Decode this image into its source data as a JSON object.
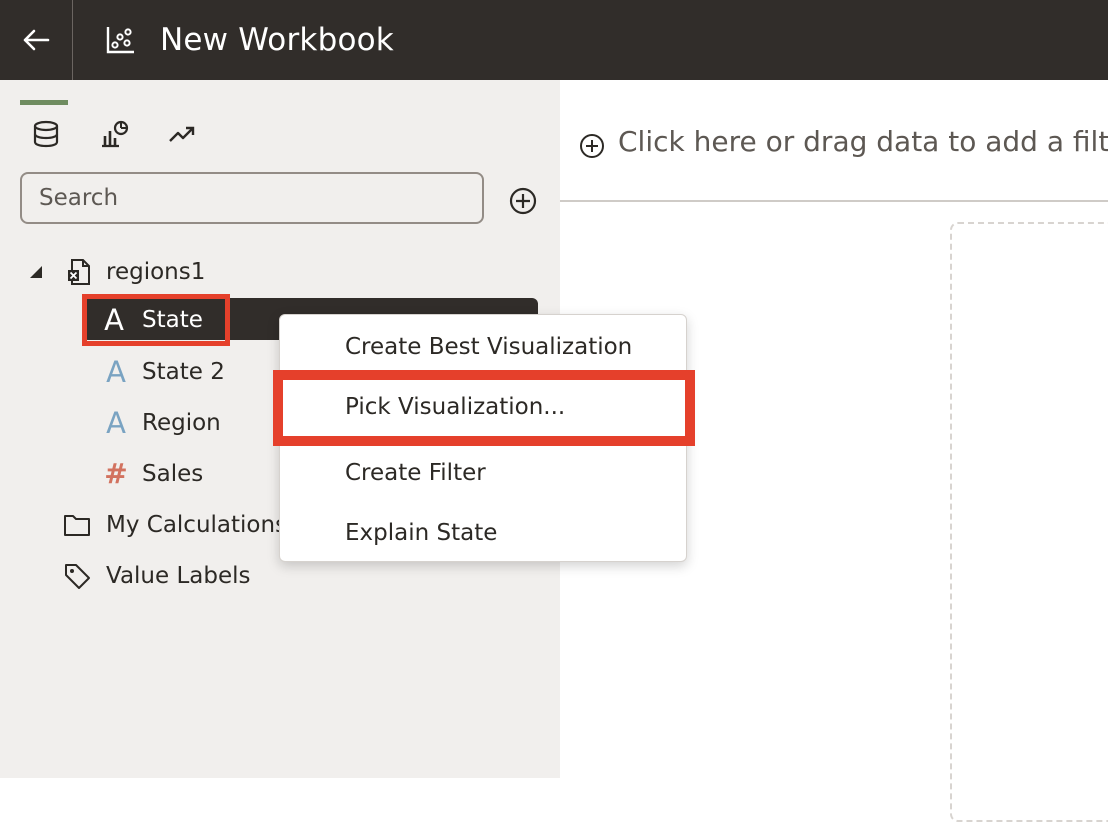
{
  "header": {
    "title": "New Workbook",
    "back_icon": "arrow-left-icon",
    "workbook_icon": "chart-icon"
  },
  "left_panel": {
    "tabs": [
      {
        "name": "data",
        "icon": "database-icon",
        "active": true
      },
      {
        "name": "visualizations",
        "icon": "visualizations-icon",
        "active": false
      },
      {
        "name": "analytics",
        "icon": "trend-icon",
        "active": false
      }
    ],
    "search": {
      "placeholder": "Search",
      "value": ""
    },
    "tree": {
      "dataset": {
        "label": "regions1",
        "icon": "excel-file-icon"
      },
      "columns": [
        {
          "label": "State",
          "type": "text",
          "selected": true
        },
        {
          "label": "State 2",
          "type": "text"
        },
        {
          "label": "Region",
          "type": "text"
        },
        {
          "label": "Sales",
          "type": "number"
        }
      ],
      "folders": [
        {
          "label": "My Calculations",
          "icon": "folder-icon"
        },
        {
          "label": "Value Labels",
          "icon": "tag-icon"
        }
      ]
    }
  },
  "filter_bar": {
    "hint": "Click here or drag data to add a filter"
  },
  "context_menu": {
    "items": [
      {
        "label": "Create Best Visualization"
      },
      {
        "label": "Pick Visualization...",
        "highlighted": true
      },
      {
        "label": "Create Filter"
      },
      {
        "label": "Explain State"
      }
    ]
  },
  "colors": {
    "topbar": "#312d2a",
    "panel": "#f1efed",
    "accent_tab": "#6f8c60",
    "text_type": "#7aa3c2",
    "number_type": "#d2725f",
    "highlight_box": "#e5402b"
  }
}
